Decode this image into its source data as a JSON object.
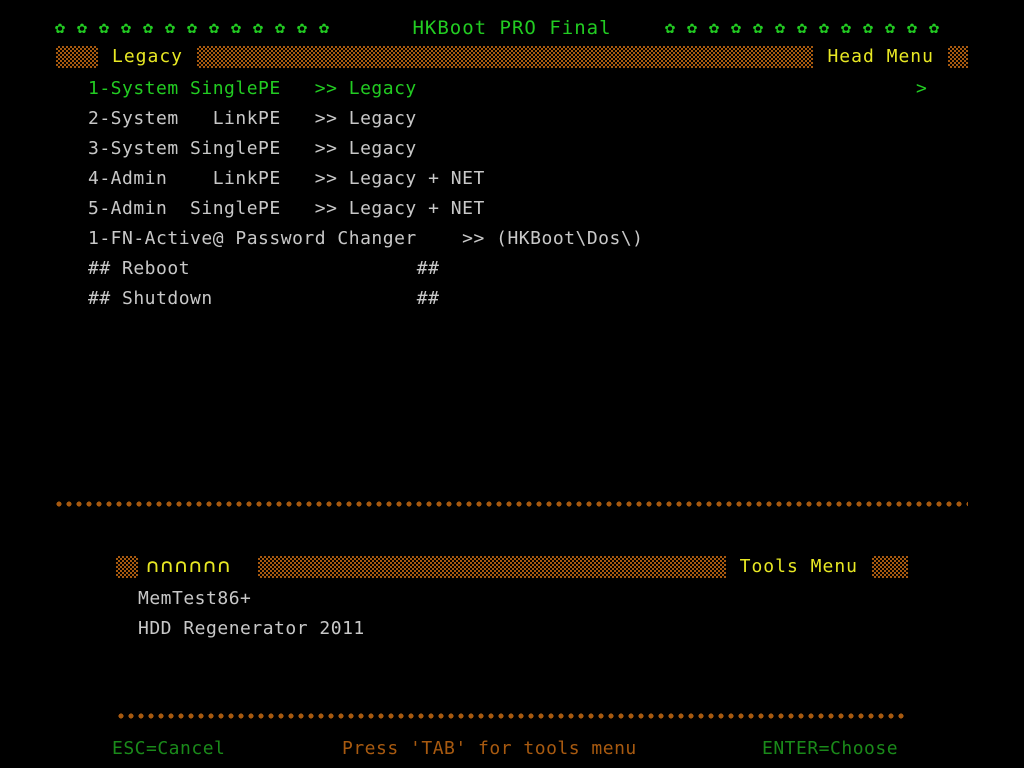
{
  "header": {
    "title": "HKBoot PRO Final",
    "decoration_glyph": "gear-flower-glyph",
    "decoration_char": "✿",
    "decoration_count_left": 13,
    "decoration_count_right": 13,
    "title_color": "#22cc22"
  },
  "head_bar": {
    "left_label": "Legacy",
    "right_label": "Head Menu",
    "label_color": "#e8e824",
    "pattern_color": "#a85a10"
  },
  "main_menu": {
    "selected_index": 0,
    "selected_marker": ">",
    "items": [
      {
        "text": "1-System SinglePE   >> Legacy",
        "selected": true
      },
      {
        "text": "2-System   LinkPE   >> Legacy",
        "selected": false
      },
      {
        "text": "3-System SinglePE   >> Legacy",
        "selected": false
      },
      {
        "text": "4-Admin    LinkPE   >> Legacy + NET",
        "selected": false
      },
      {
        "text": "5-Admin  SinglePE   >> Legacy + NET",
        "selected": false
      },
      {
        "text": "1-FN-Active@ Password Changer    >> (HKBoot\\Dos\\)",
        "selected": false
      },
      {
        "text": "## Reboot                    ##",
        "selected": false
      },
      {
        "text": "## Shutdown                  ##",
        "selected": false
      }
    ]
  },
  "tools_bar": {
    "left_label_clipped": "∩∩∩∩∩∩",
    "right_label": "Tools Menu",
    "label_color": "#e8e824"
  },
  "tools_menu": {
    "items": [
      {
        "text": "MemTest86+"
      },
      {
        "text": "HDD Regenerator 2011"
      }
    ]
  },
  "footer": {
    "esc_hint": "ESC=Cancel",
    "tab_hint": "Press 'TAB' for tools menu",
    "enter_hint": "ENTER=Choose",
    "key_color": "#1a8a1a",
    "tab_color": "#a85a10"
  },
  "separators": {
    "dot_color": "#a85a10"
  }
}
